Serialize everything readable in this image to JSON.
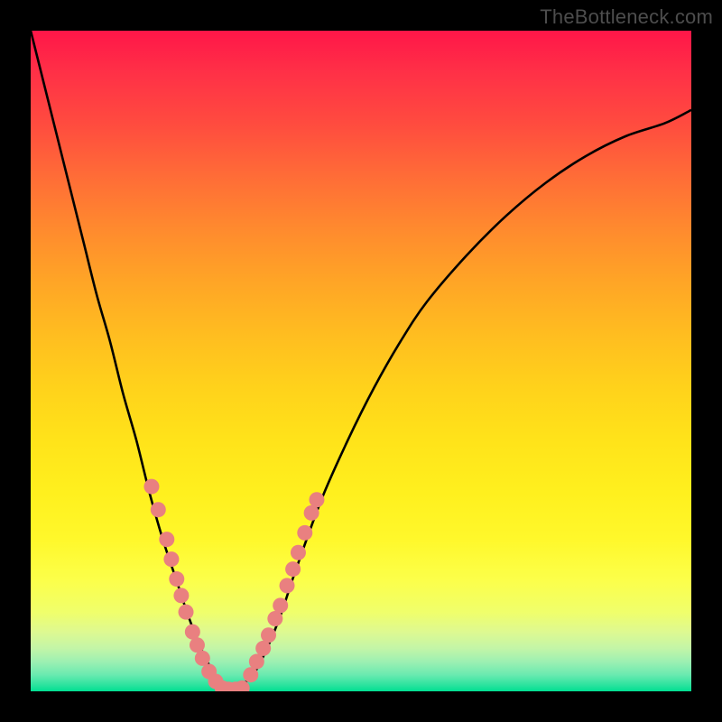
{
  "watermark": "TheBottleneck.com",
  "colors": {
    "background": "#000000",
    "curve_stroke": "#000000",
    "dot_fill": "#e98080",
    "dot_stroke": "#d86f6f"
  },
  "chart_data": {
    "type": "line",
    "title": "",
    "xlabel": "",
    "ylabel": "",
    "xlim": [
      0,
      100
    ],
    "ylim": [
      0,
      100
    ],
    "grid": false,
    "series": [
      {
        "name": "bottleneck-curve",
        "x": [
          0,
          2,
          4,
          6,
          8,
          10,
          12,
          14,
          16,
          18,
          20,
          22,
          24,
          26,
          27,
          28,
          29,
          30,
          32,
          34,
          36,
          38,
          40,
          44,
          48,
          52,
          56,
          60,
          66,
          72,
          78,
          84,
          90,
          96,
          100
        ],
        "y": [
          100,
          92,
          84,
          76,
          68,
          60,
          53,
          45,
          38,
          30,
          23,
          17,
          11,
          6,
          4,
          2,
          1,
          0,
          1,
          3,
          7,
          12,
          18,
          29,
          38,
          46,
          53,
          59,
          66,
          72,
          77,
          81,
          84,
          86,
          88
        ]
      }
    ],
    "annotations": [
      {
        "name": "threshold-dots-left",
        "type": "scatter",
        "points": [
          {
            "x": 18.3,
            "y": 31.0
          },
          {
            "x": 19.3,
            "y": 27.5
          },
          {
            "x": 20.6,
            "y": 23.0
          },
          {
            "x": 21.3,
            "y": 20.0
          },
          {
            "x": 22.1,
            "y": 17.0
          },
          {
            "x": 22.8,
            "y": 14.5
          },
          {
            "x": 23.5,
            "y": 12.0
          },
          {
            "x": 24.5,
            "y": 9.0
          },
          {
            "x": 25.2,
            "y": 7.0
          },
          {
            "x": 26.0,
            "y": 5.0
          },
          {
            "x": 27.0,
            "y": 3.0
          },
          {
            "x": 28.0,
            "y": 1.5
          }
        ]
      },
      {
        "name": "threshold-dots-bottom",
        "type": "scatter",
        "points": [
          {
            "x": 29.0,
            "y": 0.5
          },
          {
            "x": 30.0,
            "y": 0.3
          },
          {
            "x": 31.0,
            "y": 0.3
          },
          {
            "x": 32.0,
            "y": 0.5
          }
        ]
      },
      {
        "name": "threshold-dots-right",
        "type": "scatter",
        "points": [
          {
            "x": 33.3,
            "y": 2.5
          },
          {
            "x": 34.2,
            "y": 4.5
          },
          {
            "x": 35.2,
            "y": 6.5
          },
          {
            "x": 36.0,
            "y": 8.5
          },
          {
            "x": 37.0,
            "y": 11.0
          },
          {
            "x": 37.8,
            "y": 13.0
          },
          {
            "x": 38.8,
            "y": 16.0
          },
          {
            "x": 39.7,
            "y": 18.5
          },
          {
            "x": 40.5,
            "y": 21.0
          },
          {
            "x": 41.5,
            "y": 24.0
          },
          {
            "x": 42.5,
            "y": 27.0
          },
          {
            "x": 43.3,
            "y": 29.0
          }
        ]
      }
    ]
  }
}
